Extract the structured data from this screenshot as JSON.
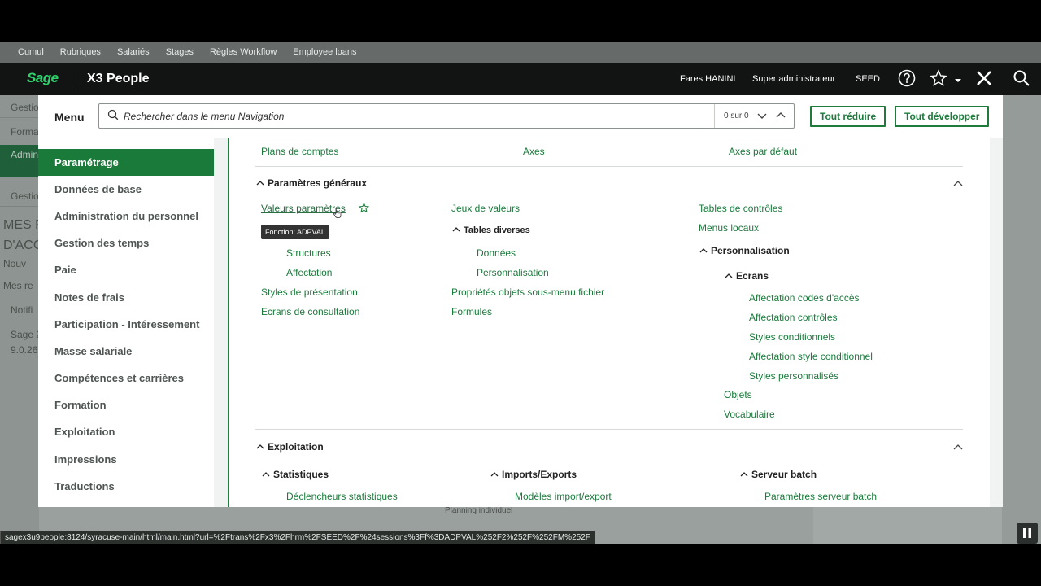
{
  "tabs": [
    "Cumul",
    "Rubriques",
    "Salariés",
    "Stages",
    "Règles Workflow",
    "Employee loans"
  ],
  "header": {
    "logo": "Sage",
    "app_title": "X3 People",
    "user": "Fares HANINI",
    "role": "Super administrateur",
    "folder": "SEED"
  },
  "background": {
    "rows": [
      "Gestio",
      "Forma",
      "Admin perso",
      "Gestio"
    ],
    "texts": [
      "MES R",
      "D'ACC",
      "Nouv",
      "Mes re",
      "Notifi",
      "Sage 2",
      "9.0.26"
    ],
    "link": "Planning individuel"
  },
  "menu": {
    "label": "Menu",
    "search_placeholder": "Rechercher dans le menu Navigation",
    "search_count": "0 sur 0",
    "collapse_all": "Tout réduire",
    "expand_all": "Tout développer",
    "nav_items": [
      "Paramétrage",
      "Données de base",
      "Administration du personnel",
      "Gestion des temps",
      "Paie",
      "Notes de frais",
      "Participation - Intéressement",
      "Masse salariale",
      "Compétences et carrières",
      "Formation",
      "Exploitation",
      "Impressions",
      "Traductions"
    ],
    "top_links": [
      "Plans de comptes",
      "Axes",
      "Axes par défaut"
    ],
    "params_generaux": {
      "title": "Paramètres généraux",
      "col1": [
        "Valeurs paramètres",
        "Structures",
        "Affectation",
        "Styles de présentation",
        "Ecrans de consultation"
      ],
      "col2": {
        "jeux": "Jeux de valeurs",
        "tables_diverses": "Tables diverses",
        "tables_diverses_items": [
          "Données",
          "Personnalisation"
        ],
        "others": [
          "Propriétés objets sous-menu fichier",
          "Formules"
        ]
      },
      "col3": {
        "items": [
          "Tables de contrôles",
          "Menus locaux"
        ],
        "personnalisation": "Personnalisation",
        "ecrans": "Ecrans",
        "ecrans_items": [
          "Affectation codes d'accès",
          "Affectation contrôles",
          "Styles conditionnels",
          "Affectation style conditionnel",
          "Styles personnalisés"
        ],
        "after": [
          "Objets",
          "Vocabulaire"
        ]
      },
      "tooltip": "Fonction: ADPVAL"
    },
    "exploitation": {
      "title": "Exploitation",
      "statistiques": "Statistiques",
      "statistiques_item": "Déclencheurs statistiques",
      "imports": "Imports/Exports",
      "imports_item": "Modèles import/export",
      "serveur": "Serveur batch",
      "serveur_item": "Paramètres serveur batch"
    }
  },
  "status_url": "sagex3u9people:8124/syracuse-main/html/main.html?url=%2Ftrans%2Fx3%2Fhrm%2FSEED%2F%24sessions%3Ff%3DADPVAL%252F2%252F%252FM%252F",
  "colors": {
    "accent": "#1a7a3a",
    "header_bg": "#111413",
    "link": "#1b7a3c"
  }
}
